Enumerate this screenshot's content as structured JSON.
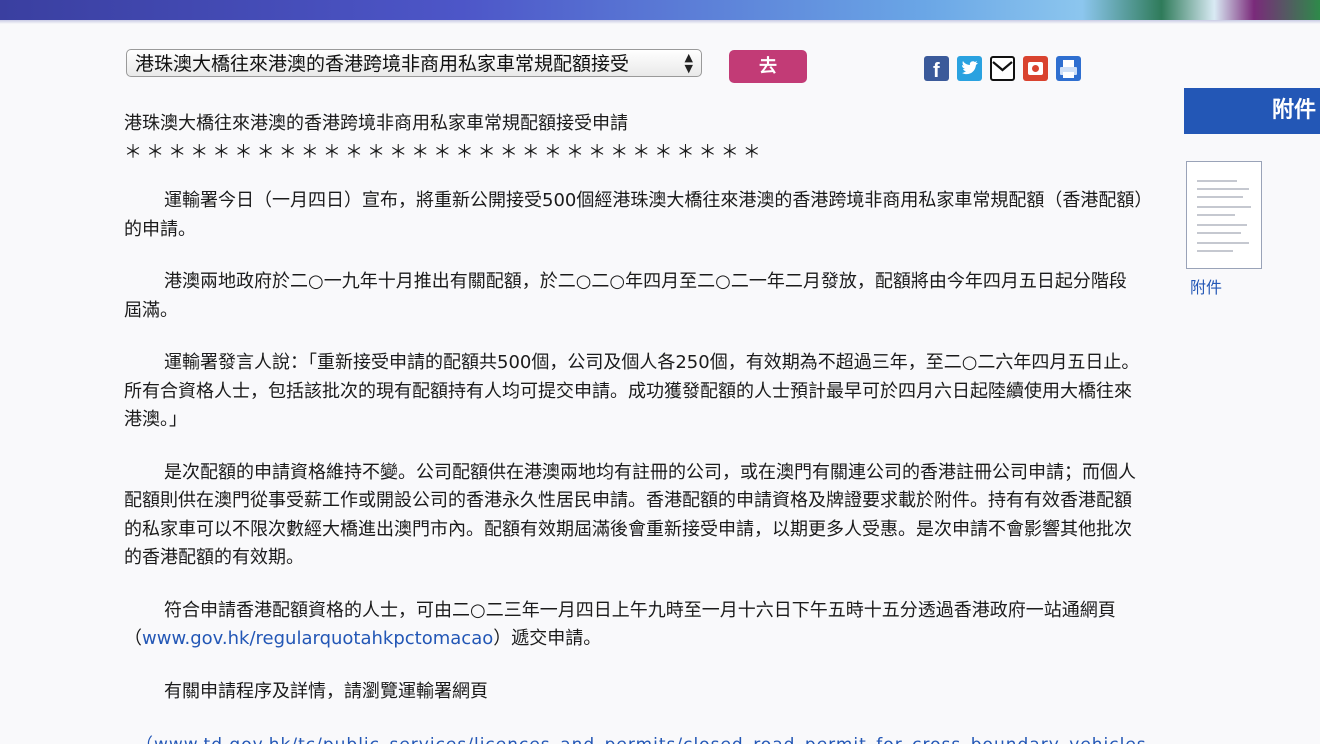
{
  "selector": {
    "selected": "港珠澳大橋往來港澳的香港跨境非商用私家車常規配額接受",
    "go_label": "去"
  },
  "share": {
    "icons": [
      "facebook-icon",
      "twitter-icon",
      "email-icon",
      "weibo-icon",
      "print-icon"
    ]
  },
  "sidebar": {
    "banner_label": "附件",
    "attachment_label": "附件"
  },
  "article": {
    "title": "港珠澳大橋往來港澳的香港跨境非商用私家車常規配額接受申請",
    "stars": "＊＊＊＊＊＊＊＊＊＊＊＊＊＊＊＊＊＊＊＊＊＊＊＊＊＊＊＊＊",
    "p1": "運輸署今日（一月四日）宣布，將重新公開接受500個經港珠澳大橋往來港澳的香港跨境非商用私家車常規配額（香港配額）的申請。",
    "p2": "港澳兩地政府於二○一九年十月推出有關配額，於二○二○年四月至二○二一年二月發放，配額將由今年四月五日起分階段屆滿。",
    "p3": "運輸署發言人說：「重新接受申請的配額共500個，公司及個人各250個，有效期為不超過三年，至二○二六年四月五日止。所有合資格人士，包括該批次的現有配額持有人均可提交申請。成功獲發配額的人士預計最早可於四月六日起陸續使用大橋往來港澳。」",
    "p4": "是次配額的申請資格維持不變。公司配額供在港澳兩地均有註冊的公司，或在澳門有關連公司的香港註冊公司申請；而個人配額則供在澳門從事受薪工作或開設公司的香港永久性居民申請。香港配額的申請資格及牌證要求載於附件。持有有效香港配額的私家車可以不限次數經大橋進出澳門市內。配額有效期屆滿後會重新接受申請，以期更多人受惠。是次申請不會影響其他批次的香港配額的有效期。",
    "p5_before": "符合申請香港配額資格的人士，可由二○二三年一月四日上午九時至一月十六日下午五時十五分透過香港政府一站通網頁（",
    "p5_link": "www.gov.hk/regularquotahkpctomacao",
    "p5_after": "）遞交申請。",
    "p6": "有關申請程序及詳情，請瀏覽運輸署網頁",
    "cut_link": "（www.td.gov.hk/tc/public_services/licences_and_permits/closed_road_permit_for_cross_boundary_vehicles/r"
  },
  "colors": {
    "go_button": "#c23b76",
    "banner": "#2357b6",
    "link": "#2357b6"
  }
}
